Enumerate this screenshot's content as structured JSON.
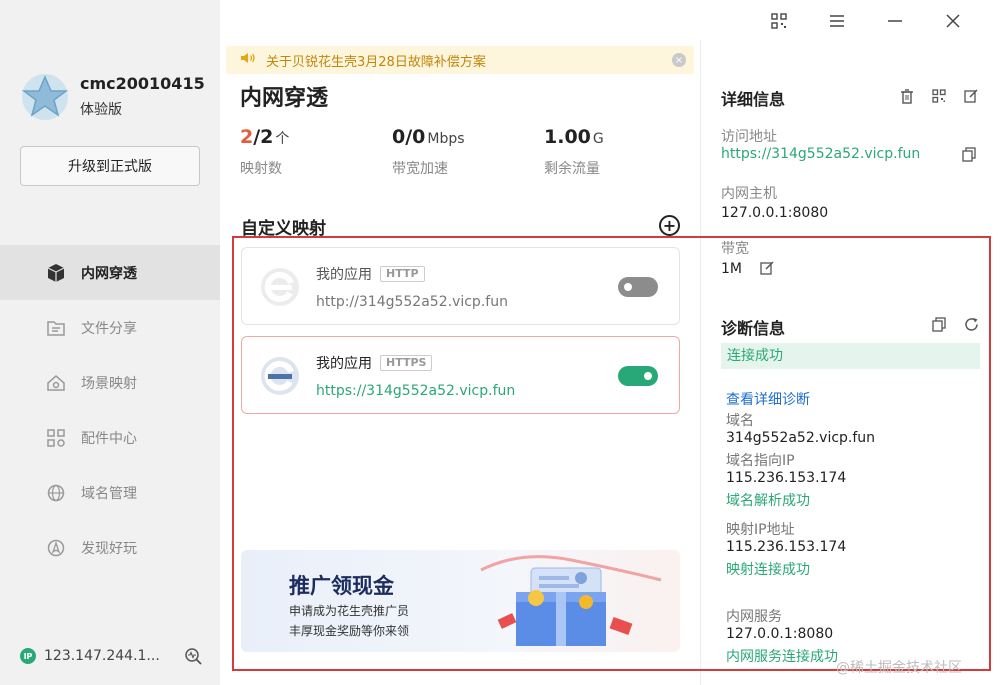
{
  "user": {
    "name": "cmc20010415",
    "edition": "体验版",
    "upgrade_label": "升级到正式版"
  },
  "nav": {
    "items": [
      {
        "label": "内网穿透",
        "icon": "cube-icon",
        "active": true
      },
      {
        "label": "文件分享",
        "icon": "folder-icon",
        "active": false
      },
      {
        "label": "场景映射",
        "icon": "house-icon",
        "active": false
      },
      {
        "label": "配件中心",
        "icon": "grid-icon",
        "active": false
      },
      {
        "label": "域名管理",
        "icon": "globe-icon",
        "active": false
      },
      {
        "label": "发现好玩",
        "icon": "compass-icon",
        "active": false
      }
    ]
  },
  "footer": {
    "ip": "123.147.244.1...",
    "ip_badge": "IP"
  },
  "notice": {
    "text": "关于贝锐花生壳3月28日故障补偿方案"
  },
  "main": {
    "title": "内网穿透",
    "stats": [
      {
        "value_hl": "2",
        "value_rest": "/2",
        "unit": "个",
        "label": "映射数"
      },
      {
        "value_hl": "",
        "value_rest": "0/0",
        "unit": "Mbps",
        "label": "带宽加速"
      },
      {
        "value_hl": "",
        "value_rest": "1.00",
        "unit": "G",
        "label": "剩余流量"
      }
    ],
    "section_title": "自定义映射",
    "mappings": [
      {
        "name": "我的应用",
        "protocol": "HTTP",
        "url": "http://314g552a52.vicp.fun",
        "enabled": false
      },
      {
        "name": "我的应用",
        "protocol": "HTTPS",
        "url": "https://314g552a52.vicp.fun",
        "enabled": true
      }
    ],
    "promo": {
      "title": "推广领现金",
      "line1": "申请成为花生壳推广员",
      "line2": "丰厚现金奖励等你来领"
    }
  },
  "details": {
    "title": "详细信息",
    "access_label": "访问地址",
    "access_url": "https://314g552a52.vicp.fun",
    "host_label": "内网主机",
    "host_value": "127.0.0.1:8080",
    "bandwidth_label": "带宽",
    "bandwidth_value": "1M"
  },
  "diagnosis": {
    "title": "诊断信息",
    "status": "连接成功",
    "detail_link": "查看详细诊断",
    "domain_label": "域名",
    "domain_value": "314g552a52.vicp.fun",
    "domain_ip_label": "域名指向IP",
    "domain_ip_value": "115.236.153.174",
    "domain_ip_status": "域名解析成功",
    "map_ip_label": "映射IP地址",
    "map_ip_value": "115.236.153.174",
    "map_ip_status": "映射连接成功",
    "service_label": "内网服务",
    "service_value": "127.0.0.1:8080",
    "service_status": "内网服务连接成功"
  },
  "watermark": "@稀土掘金技术社区",
  "colors": {
    "accent_green": "#2aa876",
    "highlight": "#e65b3a",
    "link_blue": "#1d6fd0",
    "notice_text": "#c2860a",
    "annotation_red": "#d63a3a"
  }
}
